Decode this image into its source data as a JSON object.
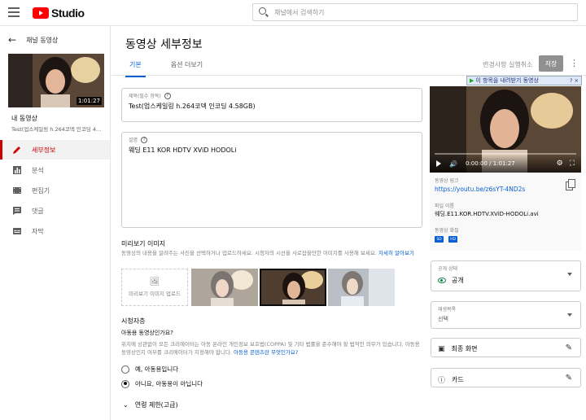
{
  "header": {
    "logo_text": "Studio",
    "search_placeholder": "채널에서 검색하기"
  },
  "sidebar": {
    "back_label": "채널 동영상",
    "thumb_duration": "1:01:27",
    "video_heading": "내 동영상",
    "video_name": "Test(업스케일링 h.264코덱 인코딩 4...",
    "items": [
      {
        "label": "세부정보",
        "icon": "pencil-icon",
        "active": true
      },
      {
        "label": "분석",
        "icon": "analytics-icon",
        "active": false
      },
      {
        "label": "편집기",
        "icon": "editor-icon",
        "active": false
      },
      {
        "label": "댓글",
        "icon": "comments-icon",
        "active": false
      },
      {
        "label": "자막",
        "icon": "subtitles-icon",
        "active": false
      }
    ]
  },
  "main": {
    "title": "동영상 세부정보",
    "tabs": [
      {
        "label": "기본",
        "active": true
      },
      {
        "label": "옵션 더보기",
        "active": false
      }
    ],
    "undo_label": "변경사항 실행취소",
    "save_label": "저장",
    "title_field": {
      "label": "제목(필수 항목)",
      "value": "Test(업스케일링 h.264코덱 인코딩 4.58GB)"
    },
    "desc_field": {
      "label": "설명",
      "value": "웨딩 E11 KOR HDTV XViD HODOLi"
    },
    "thumbnails": {
      "title": "미리보기 이미지",
      "desc": "동영상의 내용을 알려주는 사진을 선택하거나 업로드하세요. 시청자의 시선을 사로잡을만한 이미지를 사용해 보세요.",
      "link": "자세히 알아보기",
      "upload_label": "미리보기 이미지 업로드"
    },
    "audience": {
      "title": "시청자층",
      "question": "아동용 동영상인가요?",
      "desc": "위치에 상관없이 모든 크리에이터는 아동 온라인 개인정보 보호법(COPPA) 및 기타 법률을 준수해야 할 법적인 의무가 있습니다. 아동용 동영상인지 여부를 크리에이터가 지정해야 합니다.",
      "link": "아동용 콘텐츠란 무엇인가요?",
      "option_yes": "예, 아동용입니다",
      "option_no": "아니요, 아동용이 아닙니다",
      "selected": "no",
      "age_label": "연령 제한(고급)"
    }
  },
  "right": {
    "download_banner": "이 항목을 내려받기 동영상",
    "download_extra": "? ×",
    "player_time": "0:00:00 / 1:01:27",
    "link_label": "동영상 링크",
    "link_value": "https://youtu.be/z6sYT-4ND2s",
    "filename_label": "파일 이름",
    "filename_value": "웨딩.E11.KOR.HDTV.XViD-HODOLi.avi",
    "quality_label": "동영상 화질",
    "quality_badges": [
      "SD",
      "HD"
    ],
    "visibility_label": "공개 상태",
    "visibility_value": "공개",
    "playlist_label": "재생목록",
    "playlist_value": "선택",
    "endscreen_label": "최종 화면",
    "cards_label": "카드"
  }
}
